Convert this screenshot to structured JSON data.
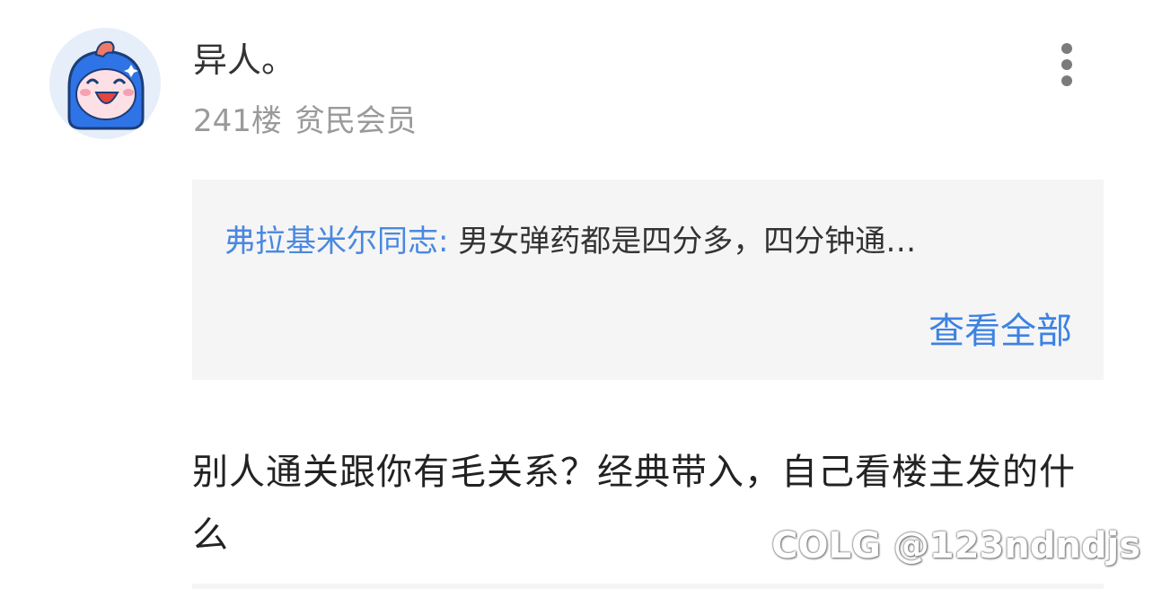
{
  "post": {
    "username": "异人。",
    "floor": "241楼",
    "member_level": "贫民会员",
    "quote": {
      "author": "弗拉基米尔同志:",
      "text": " 男女弹药都是四分多，四分钟通…",
      "view_all_label": "查看全部"
    },
    "reply_text": "别人通关跟你有毛关系？经典带入，自己看楼主发的什么"
  },
  "watermark": "COLG @123ndndjs",
  "colors": {
    "link_blue": "#3d82e3",
    "quote_bg": "#f5f5f5",
    "meta_gray": "#9a9a9a",
    "avatar_blue": "#2f74e6"
  },
  "icons": {
    "avatar": "cartoon-face-avatar",
    "more": "more-vertical-icon"
  }
}
